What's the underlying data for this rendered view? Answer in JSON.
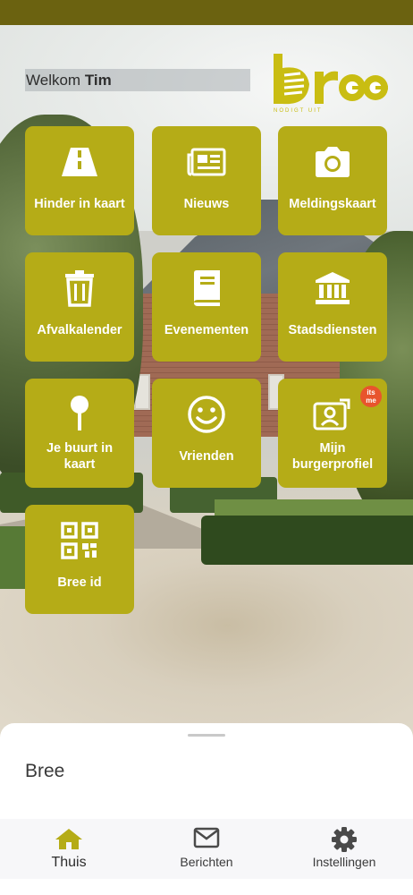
{
  "header": {
    "welcome_prefix": "Welkom",
    "user_name": "Tim",
    "logo_text": "bree",
    "logo_tagline": "NODIGT UIT"
  },
  "tiles": [
    {
      "label": "Hinder in kaart",
      "icon": "road-icon"
    },
    {
      "label": "Nieuws",
      "icon": "newspaper-icon"
    },
    {
      "label": "Meldingskaart",
      "icon": "camera-icon"
    },
    {
      "label": "Afvalkalender",
      "icon": "trash-icon"
    },
    {
      "label": "Evenementen",
      "icon": "book-icon"
    },
    {
      "label": "Stadsdiensten",
      "icon": "city-hall-icon"
    },
    {
      "label_line1": "Je buurt in",
      "label_line2": "kaart",
      "icon": "map-pin-icon"
    },
    {
      "label": "Vrienden",
      "icon": "smiley-icon"
    },
    {
      "label_line1": "Mijn",
      "label_line2": "burgerprofiel",
      "icon": "profile-id-icon",
      "badge_line1": "its",
      "badge_line2": "me"
    },
    {
      "label": "Bree id",
      "icon": "qr-code-icon"
    }
  ],
  "sheet": {
    "title": "Bree"
  },
  "nav": [
    {
      "label": "Thuis",
      "icon": "home-icon",
      "active": true
    },
    {
      "label": "Berichten",
      "icon": "envelope-icon",
      "active": false
    },
    {
      "label": "Instellingen",
      "icon": "gear-icon",
      "active": false
    }
  ],
  "colors": {
    "tile": "#b5ac17",
    "status_bar": "#6b6210",
    "brand": "#c9bd12",
    "badge": "#e8542d"
  }
}
